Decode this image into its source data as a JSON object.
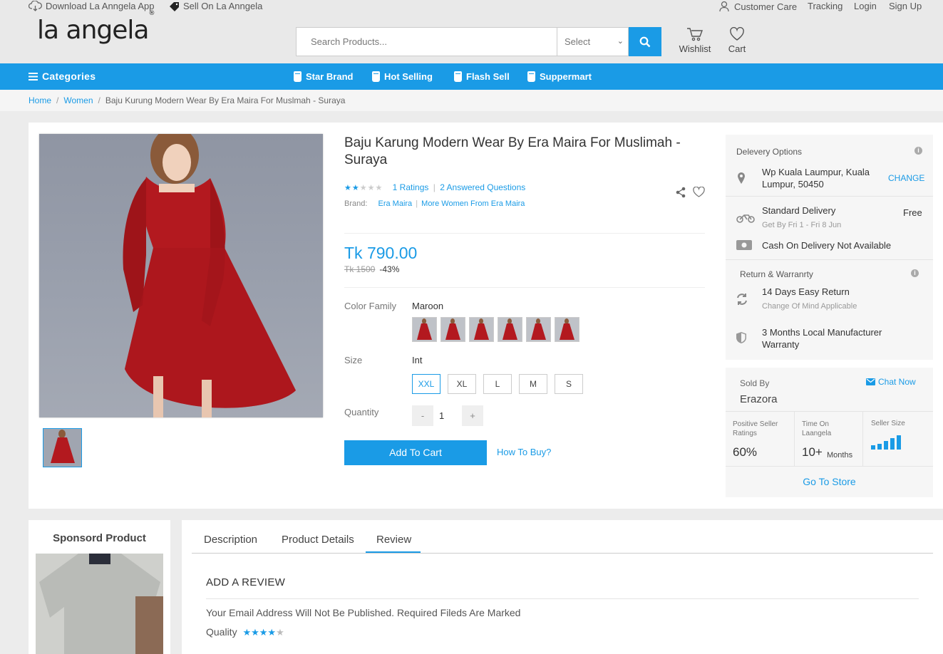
{
  "topbar": {
    "download_app": "Download La Anngela App",
    "sell_on": "Sell On La Anngela",
    "customer_care": "Customer Care",
    "tracking": "Tracking",
    "login": "Login",
    "signup": "Sign Up"
  },
  "header": {
    "logo": "la angela",
    "logo_mark": "®",
    "search_placeholder": "Search Products...",
    "select_label": "Select",
    "wishlist": "Wishlist",
    "cart": "Cart"
  },
  "nav": {
    "categories": "Categories",
    "items": [
      "Star Brand",
      "Hot Selling",
      "Flash Sell",
      "Suppermart"
    ]
  },
  "breadcrumb": {
    "items": [
      "Home",
      "Women"
    ],
    "current": "Baju Kurung Modern Wear By Era Maira For Muslmah - Suraya"
  },
  "product": {
    "title": "Baju Karung Modern Wear By Era Maira For Muslimah - Suraya",
    "rating": 2,
    "rating_max": 5,
    "ratings_text": "1 Ratings",
    "questions_text": "2 Answered Questions",
    "brand_label": "Brand:",
    "brand": "Era Maira",
    "more_from": "More Women From Era Maira",
    "price": "Tk 790.00",
    "old_price": "Tk 1500",
    "discount": "-43%",
    "color_label": "Color Family",
    "color_value": "Maroon",
    "size_label": "Size",
    "size_value": "Int",
    "sizes": [
      "XXL",
      "XL",
      "L",
      "M",
      "S"
    ],
    "selected_size": "XXL",
    "quantity_label": "Quantity",
    "quantity": "1",
    "qty_minus": "-",
    "qty_plus": "+",
    "add_to_cart": "Add To Cart",
    "how_to_buy": "How To Buy?"
  },
  "delivery": {
    "title": "Delevery Options",
    "location": "Wp Kuala Laumpur, Kuala Lumpur, 50450",
    "change": "CHANGE",
    "standard": "Standard Delivery",
    "standard_price": "Free",
    "eta": "Get By Fri 1 - Fri 8 Jun",
    "cod": "Cash On Delivery Not Available",
    "return_title": "Return & Warranrty",
    "return_days": "14 Days Easy Return",
    "return_note": "Change Of Mind Applicable",
    "warranty": "3 Months Local Manufacturer Warranty"
  },
  "seller": {
    "sold_by": "Sold By",
    "name": "Erazora",
    "chat": "Chat Now",
    "positive_label": "Positive Seller Ratings",
    "positive_value": "60%",
    "time_label": "Time On Laangela",
    "time_value": "10+",
    "time_unit": "Months",
    "size_label": "Seller Size",
    "size_level": 5,
    "go_to_store": "Go To Store"
  },
  "sponsor": {
    "title": "Sponsord Product"
  },
  "tabs": {
    "items": [
      "Description",
      "Product Details",
      "Review"
    ],
    "active": "Review",
    "review_heading": "ADD A REVIEW",
    "review_note": "Your Email Address Will Not Be Published. Required Fileds Are Marked",
    "quality_label": "Quality",
    "quality_rating": 4
  },
  "colors": {
    "accent": "#1a9be6",
    "dress": "#b3191f"
  }
}
